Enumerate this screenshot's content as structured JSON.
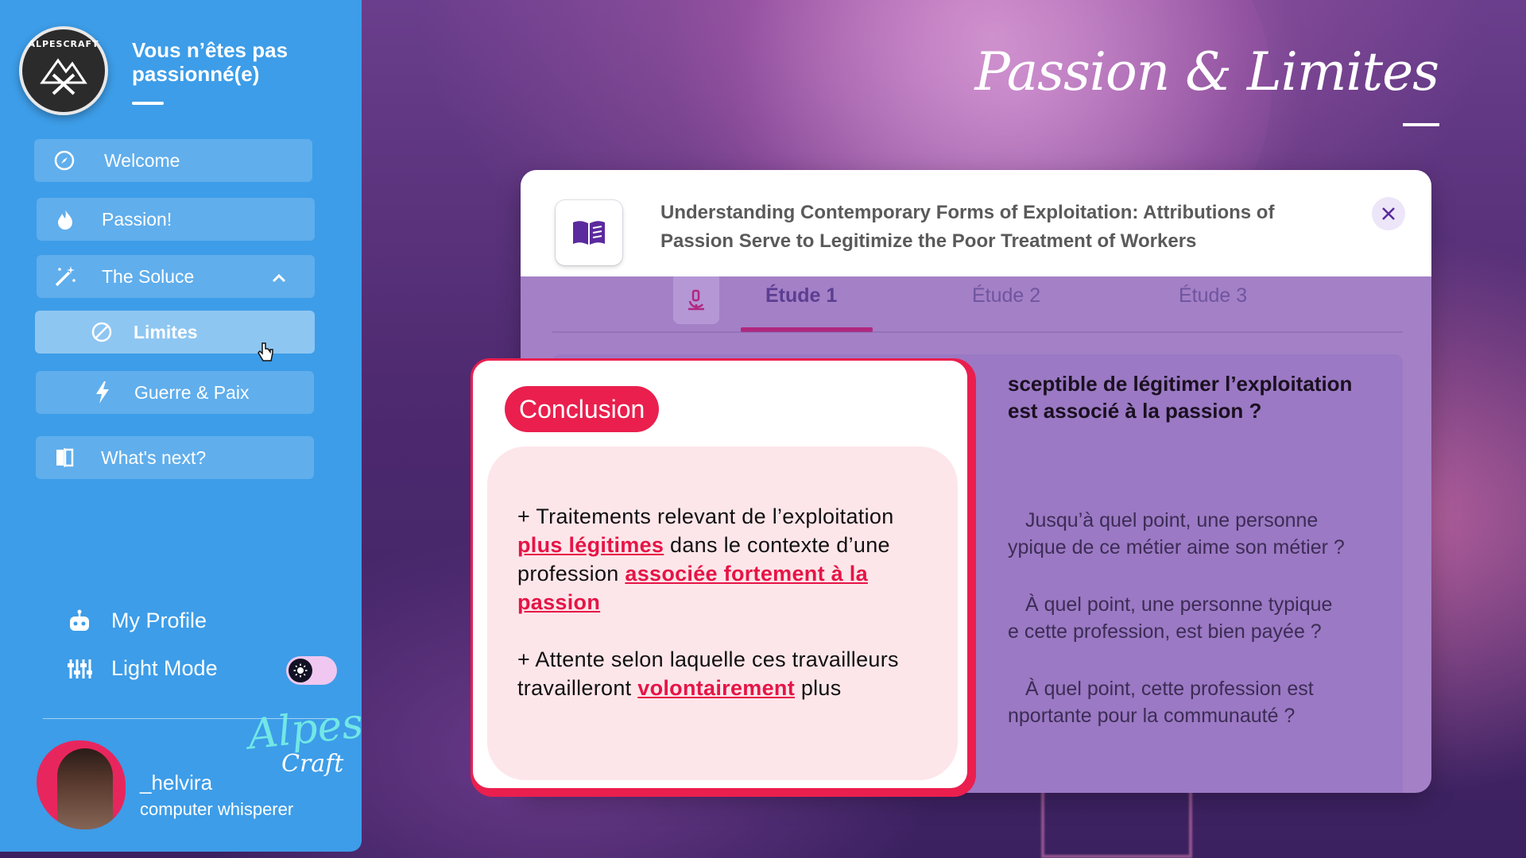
{
  "sidebar": {
    "logo_text": "ALPESCRAFT",
    "brand_title": "Vous n’êtes pas passionné(e)",
    "items": [
      {
        "label": "Welcome"
      },
      {
        "label": "Passion!"
      },
      {
        "label": "The Soluce"
      },
      {
        "label": "Limites"
      },
      {
        "label": "Guerre & Paix"
      },
      {
        "label": "What's next?"
      }
    ],
    "my_profile": "My Profile",
    "light_mode": "Light Mode",
    "user": {
      "name": "_helvira",
      "role": "computer whisperer"
    },
    "signature": {
      "line1": "Alpes",
      "line2": "Craft"
    }
  },
  "page_title": "Passion & Limites",
  "card": {
    "title": "Understanding Contemporary Forms of Exploitation: Attributions of Passion Serve to Legitimize the Poor Treatment of Workers",
    "tabs": [
      "Étude 1",
      "Étude 2",
      "Étude 3"
    ],
    "active_tab": "Étude 1",
    "question_line1": "sceptible de légitimer l’exploitation",
    "question_line2": "est associé à la passion ?",
    "items": [
      {
        "line1": "Jusqu’à quel point, une personne",
        "line2": "ypique de ce métier aime son métier ?"
      },
      {
        "line1": "À quel point, une personne typique",
        "line2": "e cette profession, est bien payée ?"
      },
      {
        "line1": "À quel point, cette profession est",
        "line2": "nportante pour la communauté ?"
      }
    ]
  },
  "conclusion": {
    "badge": "Conclusion",
    "p1": {
      "t1": "+ Traitements relevant de l’exploitation ",
      "h1": "plus légitimes",
      "t2": " dans le contexte d’une profession ",
      "h2": "associée fortement à la passion"
    },
    "p2": {
      "t1": "+ Attente selon laquelle ces travailleurs travailleront ",
      "h1": "volontairement",
      "t2": " plus"
    }
  },
  "colors": {
    "sidebar": "#3d9de8",
    "accent": "#ea1f4e",
    "tab_underline": "#b1277e",
    "card_purple": "#a480c6"
  },
  "icons": [
    "compass-icon",
    "fire-icon",
    "magic-wand-icon",
    "chevron-up-icon",
    "ban-icon",
    "bolt-icon",
    "book-flip-icon",
    "robot-icon",
    "sliders-icon",
    "sun-icon",
    "open-book-icon",
    "close-icon",
    "microscope-icon",
    "cursor-hand-icon"
  ]
}
